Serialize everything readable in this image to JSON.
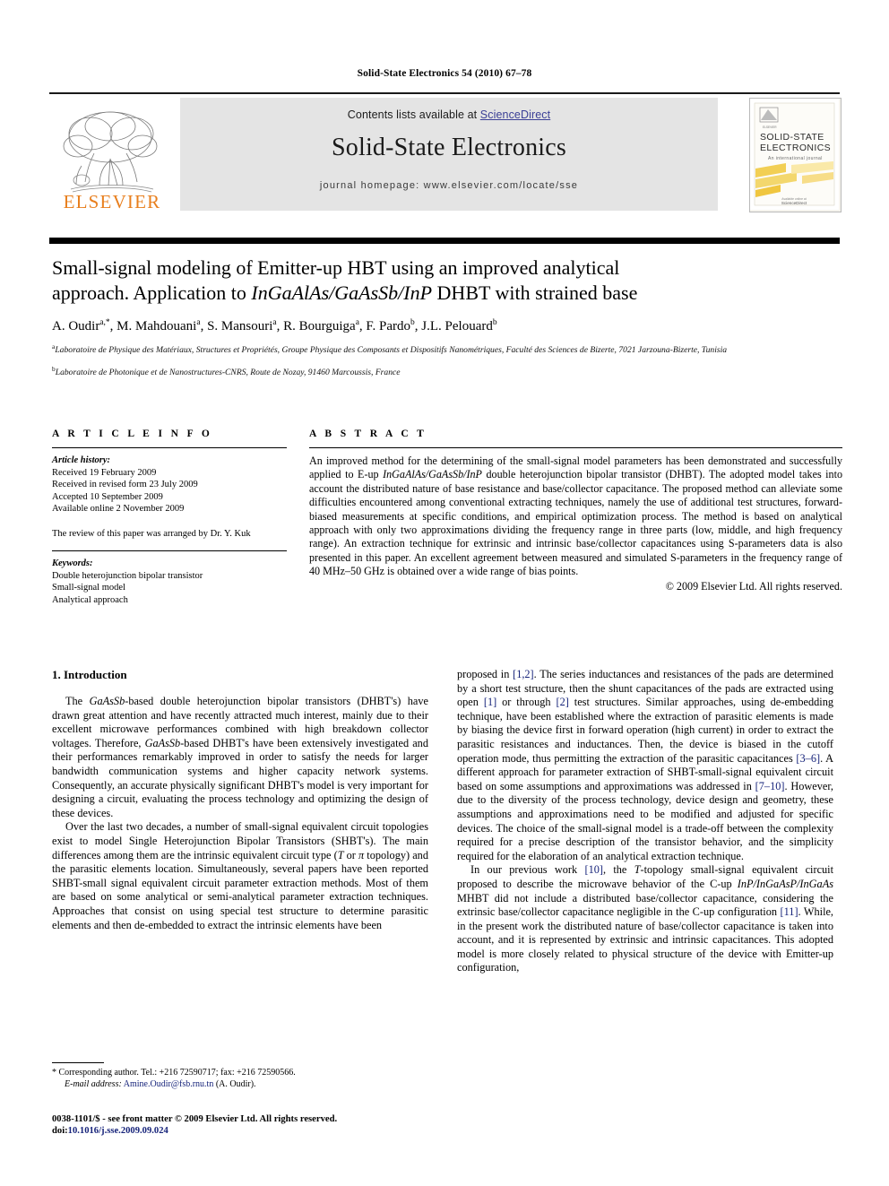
{
  "running_head": "Solid-State Electronics 54 (2010) 67–78",
  "header": {
    "contents_prefix": "Contents lists available at ",
    "sciencedirect": "ScienceDirect",
    "journal_title": "Solid-State Electronics",
    "homepage": "journal homepage: www.elsevier.com/locate/sse",
    "publisher_logo_text": "ELSEVIER",
    "cover": {
      "line1": "SOLID-STATE",
      "line2": "ELECTRONICS",
      "subtitle": "An international journal",
      "footer": "ScienceDirect"
    },
    "link_color": "#3b3f96",
    "logo_color": "#E87F1E",
    "band_color": "#e4e4e4"
  },
  "article": {
    "title_line1": "Small-signal modeling of Emitter-up HBT using an improved analytical",
    "title_line2_pre": "approach. Application to ",
    "title_line2_italic": "InGaAlAs/GaAsSb/InP",
    "title_line2_post": " DHBT with strained base",
    "authors": "A. Oudir a,*, M. Mahdouani a, S. Mansouri a, R. Bourguiga a, F. Pardo b, J.L. Pelouard b",
    "affiliation_a": "Laboratoire de Physique des Matériaux, Structures et Propriétés, Groupe Physique des Composants et Dispositifs Nanométriques, Faculté des Sciences de Bizerte, 7021 Jarzouna-Bizerte, Tunisia",
    "affiliation_b": "Laboratoire de Photonique et de Nanostructures-CNRS, Route de Nozay, 91460 Marcoussis, France"
  },
  "article_info": {
    "heading": "A R T I C L E  I N F O",
    "history_label": "Article history:",
    "history": [
      "Received 19 February 2009",
      "Received in revised form 23 July 2009",
      "Accepted 10 September 2009",
      "Available online 2 November 2009"
    ],
    "review_note": "The review of this paper was arranged by Dr. Y. Kuk",
    "keywords_label": "Keywords:",
    "keywords": [
      "Double heterojunction bipolar transistor",
      "Small-signal model",
      "Analytical approach"
    ]
  },
  "abstract": {
    "heading": "A B S T R A C T",
    "part1": "An improved method for the determining of the small-signal model parameters has been demonstrated and successfully applied to E-up ",
    "italic1": "InGaAlAs/GaAsSb/InP",
    "part2": " double heterojunction bipolar transistor (DHBT). The adopted model takes into account the distributed nature of base resistance and base/collector capacitance. The proposed method can alleviate some difficulties encountered among conventional extracting techniques, namely the use of additional test structures, forward-biased measurements at specific conditions, and empirical optimization process. The method is based on analytical approach with only two approximations dividing the frequency range in three parts (low, middle, and high frequency range). An extraction technique for extrinsic and intrinsic base/collector capacitances using S-parameters data is also presented in this paper. An excellent agreement between measured and simulated S-parameters in the frequency range of 40 MHz–50 GHz is obtained over a wide range of bias points.",
    "copyright": "© 2009 Elsevier Ltd. All rights reserved."
  },
  "body": {
    "section_title": "1. Introduction",
    "left": {
      "p1_pre": "The ",
      "p1_italic1": "GaAsSb",
      "p1_mid1": "-based double heterojunction bipolar transistors (DHBT's) have drawn great attention and have recently attracted much interest, mainly due to their excellent microwave performances combined with high breakdown collector voltages. Therefore, ",
      "p1_italic2": "GaAsSb",
      "p1_post": "-based DHBT's have been extensively investigated and their performances remarkably improved in order to satisfy the needs for larger bandwidth communication systems and higher capacity network systems. Consequently, an accurate physically significant DHBT's model is very important for designing a circuit, evaluating the process technology and optimizing the design of these devices.",
      "p2_pre": "Over the last two decades, a number of small-signal equivalent circuit topologies exist to model Single Heterojunction Bipolar Transistors (SHBT's). The main differences among them are the intrinsic equivalent circuit type (",
      "p2_italic1": "T",
      "p2_mid1": " or ",
      "p2_italic2": "π",
      "p2_post": " topology) and the parasitic elements location. Simultaneously, several papers have been reported SHBT-small signal equivalent circuit parameter extraction methods. Most of them are based on some analytical or semi-analytical parameter extraction techniques. Approaches that consist on using special test structure to determine parasitic elements and then de-embedded to extract the intrinsic elements have been"
    },
    "right": {
      "p1_a": "proposed in ",
      "p1_ref1": "[1,2]",
      "p1_b": ". The series inductances and resistances of the pads are determined by a short test structure, then the shunt capacitances of the pads are extracted using open ",
      "p1_ref2": "[1]",
      "p1_c": " or through ",
      "p1_ref3": "[2]",
      "p1_d": " test structures. Similar approaches, using de-embedding technique, have been established where the extraction of parasitic elements is made by biasing the device first in forward operation (high current) in order to extract the parasitic resistances and inductances. Then, the device is biased in the cutoff operation mode, thus permitting the extraction of the parasitic capacitances ",
      "p1_ref4": "[3–6]",
      "p1_e": ". A different approach for parameter extraction of SHBT-small-signal equivalent circuit based on some assumptions and approximations was addressed in ",
      "p1_ref5": "[7–10]",
      "p1_f": ". However, due to the diversity of the process technology, device design and geometry, these assumptions and approximations need to be modified and adjusted for specific devices. The choice of the small-signal model is a trade-off between the complexity required for a precise description of the transistor behavior, and the simplicity required for the elaboration of an analytical extraction technique.",
      "p2_a": "In our previous work ",
      "p2_ref1": "[10]",
      "p2_b": ", the ",
      "p2_italic1": "T",
      "p2_c": "-topology small-signal equivalent circuit proposed to describe the microwave behavior of the C-up ",
      "p2_italic2": "InP/InGaAsP/InGaAs",
      "p2_d": " MHBT did not include a distributed base/collector capacitance, considering the extrinsic base/collector capacitance negligible in the C-up configuration ",
      "p2_ref2": "[11]",
      "p2_e": ". While, in the present work the distributed nature of base/collector capacitance is taken into account, and it is represented by extrinsic and intrinsic capacitances. This adopted model is more closely related to physical structure of the device with Emitter-up configuration,"
    }
  },
  "footnote": {
    "marker": "*",
    "line1": "Corresponding author. Tel.: +216 72590717; fax: +216 72590566.",
    "email_label": "E-mail address:",
    "email": "Amine.Oudir@fsb.rnu.tn",
    "email_suffix": "(A. Oudir)."
  },
  "imprint": {
    "line1": "0038-1101/$ - see front matter © 2009 Elsevier Ltd. All rights reserved.",
    "doi_prefix": "doi:",
    "doi": "10.1016/j.sse.2009.09.024"
  }
}
